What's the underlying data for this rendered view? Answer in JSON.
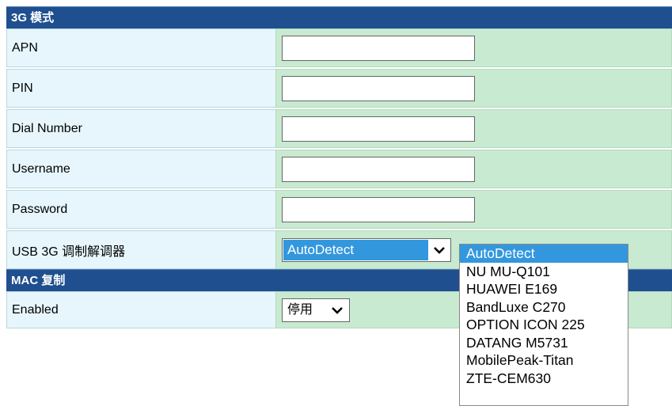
{
  "section_3g": {
    "title": "3G 模式",
    "apn_label": "APN",
    "apn_value": "",
    "pin_label": "PIN",
    "pin_value": "",
    "dial_label": "Dial Number",
    "dial_value": "",
    "username_label": "Username",
    "username_value": "",
    "password_label": "Password",
    "password_value": "",
    "modem_label": "USB 3G 调制解调器",
    "modem_selected": "AutoDetect"
  },
  "section_mac": {
    "title": "MAC 复制",
    "enabled_label": "Enabled",
    "enabled_value": "停用"
  },
  "modem_dropdown": {
    "options": [
      "AutoDetect",
      "NU MU-Q101",
      "HUAWEI E169",
      "BandLuxe C270",
      "OPTION ICON 225",
      "DATANG M5731",
      "MobilePeak-Titan",
      "ZTE-CEM630"
    ],
    "highlighted": "AutoDetect"
  },
  "colors": {
    "header_bg": "#1f4f8f",
    "label_bg": "#e6f6fc",
    "value_bg": "#c8ead0",
    "highlight": "#3397de"
  },
  "icons": {
    "select_arrow": "chevron-down-icon"
  }
}
